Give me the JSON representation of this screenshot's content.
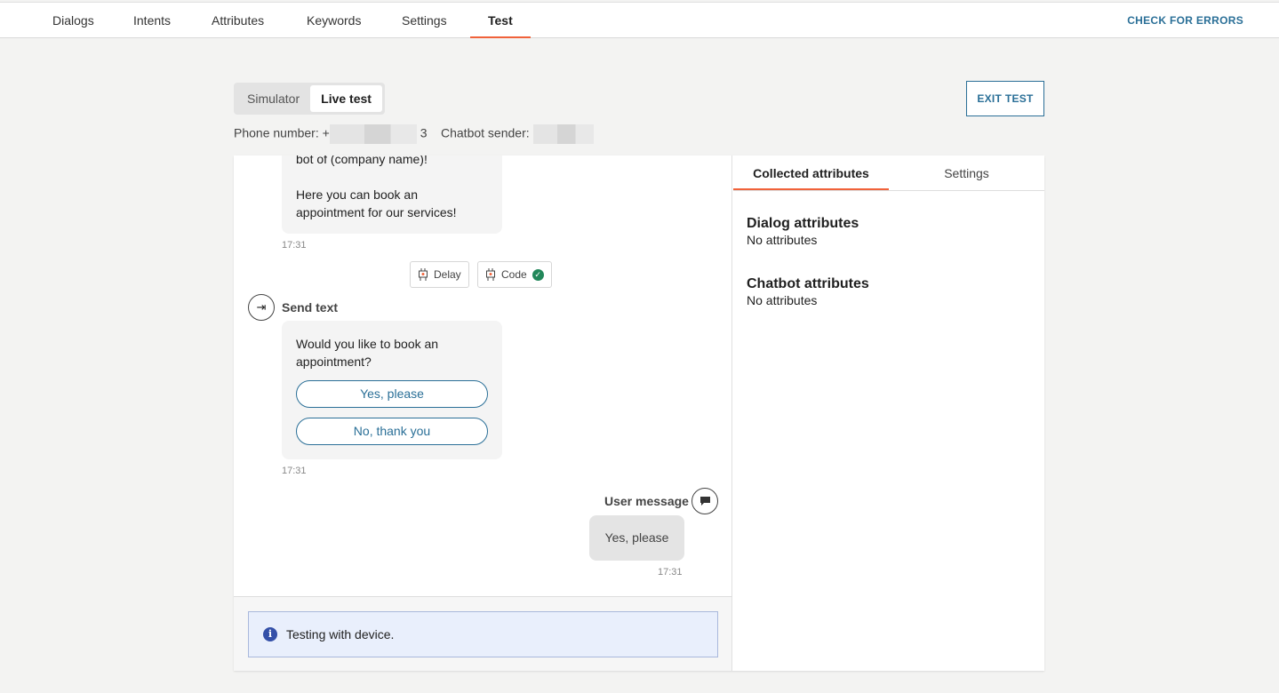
{
  "nav": {
    "tabs": [
      {
        "label": "Dialogs"
      },
      {
        "label": "Intents"
      },
      {
        "label": "Attributes"
      },
      {
        "label": "Keywords"
      },
      {
        "label": "Settings"
      },
      {
        "label": "Test"
      }
    ],
    "active": "Test",
    "check_errors": "CHECK FOR ERRORS"
  },
  "mode": {
    "simulator": "Simulator",
    "live": "Live test",
    "exit": "EXIT TEST"
  },
  "meta": {
    "phone_label": "Phone number:",
    "phone_prefix": "+",
    "phone_suffix": "3",
    "sender_label": "Chatbot sender:"
  },
  "chat": {
    "msg1": {
      "line1": "bot of (company name)!",
      "line2": "Here you can book an appointment for our services!",
      "time": "17:31"
    },
    "chips": [
      {
        "label": "Delay",
        "icon": "robot-icon"
      },
      {
        "label": "Code",
        "icon": "robot-icon",
        "status": "success"
      }
    ],
    "send_text": {
      "label": "Send text",
      "text": "Would you like to book an appointment?",
      "buttons": [
        "Yes, please",
        "No, thank you"
      ],
      "time": "17:31"
    },
    "user": {
      "label": "User message",
      "text": "Yes, please",
      "time": "17:31"
    },
    "info": "Testing with device."
  },
  "side": {
    "tabs": [
      "Collected attributes",
      "Settings"
    ],
    "dialog_title": "Dialog attributes",
    "dialog_value": "No attributes",
    "chatbot_title": "Chatbot attributes",
    "chatbot_value": "No attributes"
  },
  "colors": {
    "accent": "#f0623a",
    "link": "#2a6f97",
    "success": "#22875a",
    "info": "#3450a8"
  }
}
